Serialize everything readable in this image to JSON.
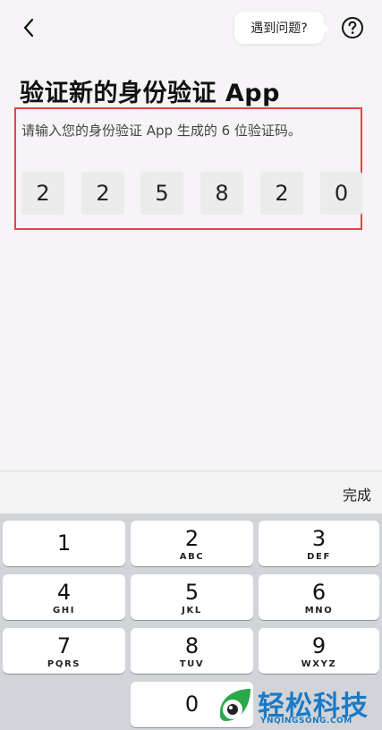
{
  "header": {
    "back_icon": "chevron-left-icon",
    "help_label": "遇到问题?",
    "help_icon": "question-circle-icon"
  },
  "main": {
    "title": "验证新的身份验证 App",
    "subtitle": "请输入您的身份验证 App 生成的 6 位验证码。",
    "code_digits": [
      "2",
      "2",
      "5",
      "8",
      "2",
      "0"
    ],
    "highlight_color": "#e8414a"
  },
  "keyboard": {
    "done_label": "完成",
    "keys": [
      {
        "num": "1",
        "letters": ""
      },
      {
        "num": "2",
        "letters": "ABC"
      },
      {
        "num": "3",
        "letters": "DEF"
      },
      {
        "num": "4",
        "letters": "GHI"
      },
      {
        "num": "5",
        "letters": "JKL"
      },
      {
        "num": "6",
        "letters": "MNO"
      },
      {
        "num": "7",
        "letters": "PQRS"
      },
      {
        "num": "8",
        "letters": "TUV"
      },
      {
        "num": "9",
        "letters": "WXYZ"
      },
      {
        "num": "0",
        "letters": ""
      }
    ]
  },
  "watermark": {
    "text": "轻松科技",
    "url": "YNQINGSONG.COM",
    "color": "#1a7ac6"
  }
}
